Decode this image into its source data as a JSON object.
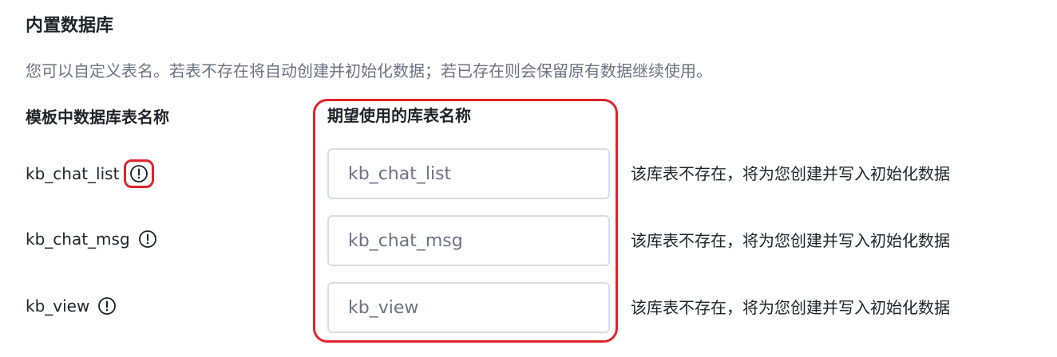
{
  "section": {
    "title": "内置数据库",
    "description": "您可以自定义表名。若表不存在将自动创建并初始化数据；若已存在则会保留原有数据继续使用。"
  },
  "columns": {
    "template_header": "模板中数据库表名称",
    "desired_header": "期望使用的库表名称"
  },
  "rows": [
    {
      "template_name": "kb_chat_list",
      "input_value": "kb_chat_list",
      "status": "该库表不存在，将为您创建并写入初始化数据"
    },
    {
      "template_name": "kb_chat_msg",
      "input_value": "kb_chat_msg",
      "status": "该库表不存在，将为您创建并写入初始化数据"
    },
    {
      "template_name": "kb_view",
      "input_value": "kb_view",
      "status": "该库表不存在，将为您创建并写入初始化数据"
    }
  ],
  "icons": {
    "info": "info-circle-icon"
  },
  "colors": {
    "highlight": "#e0242c",
    "text_primary": "#1f2329",
    "text_secondary": "#6b7280",
    "input_border": "#d9dde3"
  }
}
